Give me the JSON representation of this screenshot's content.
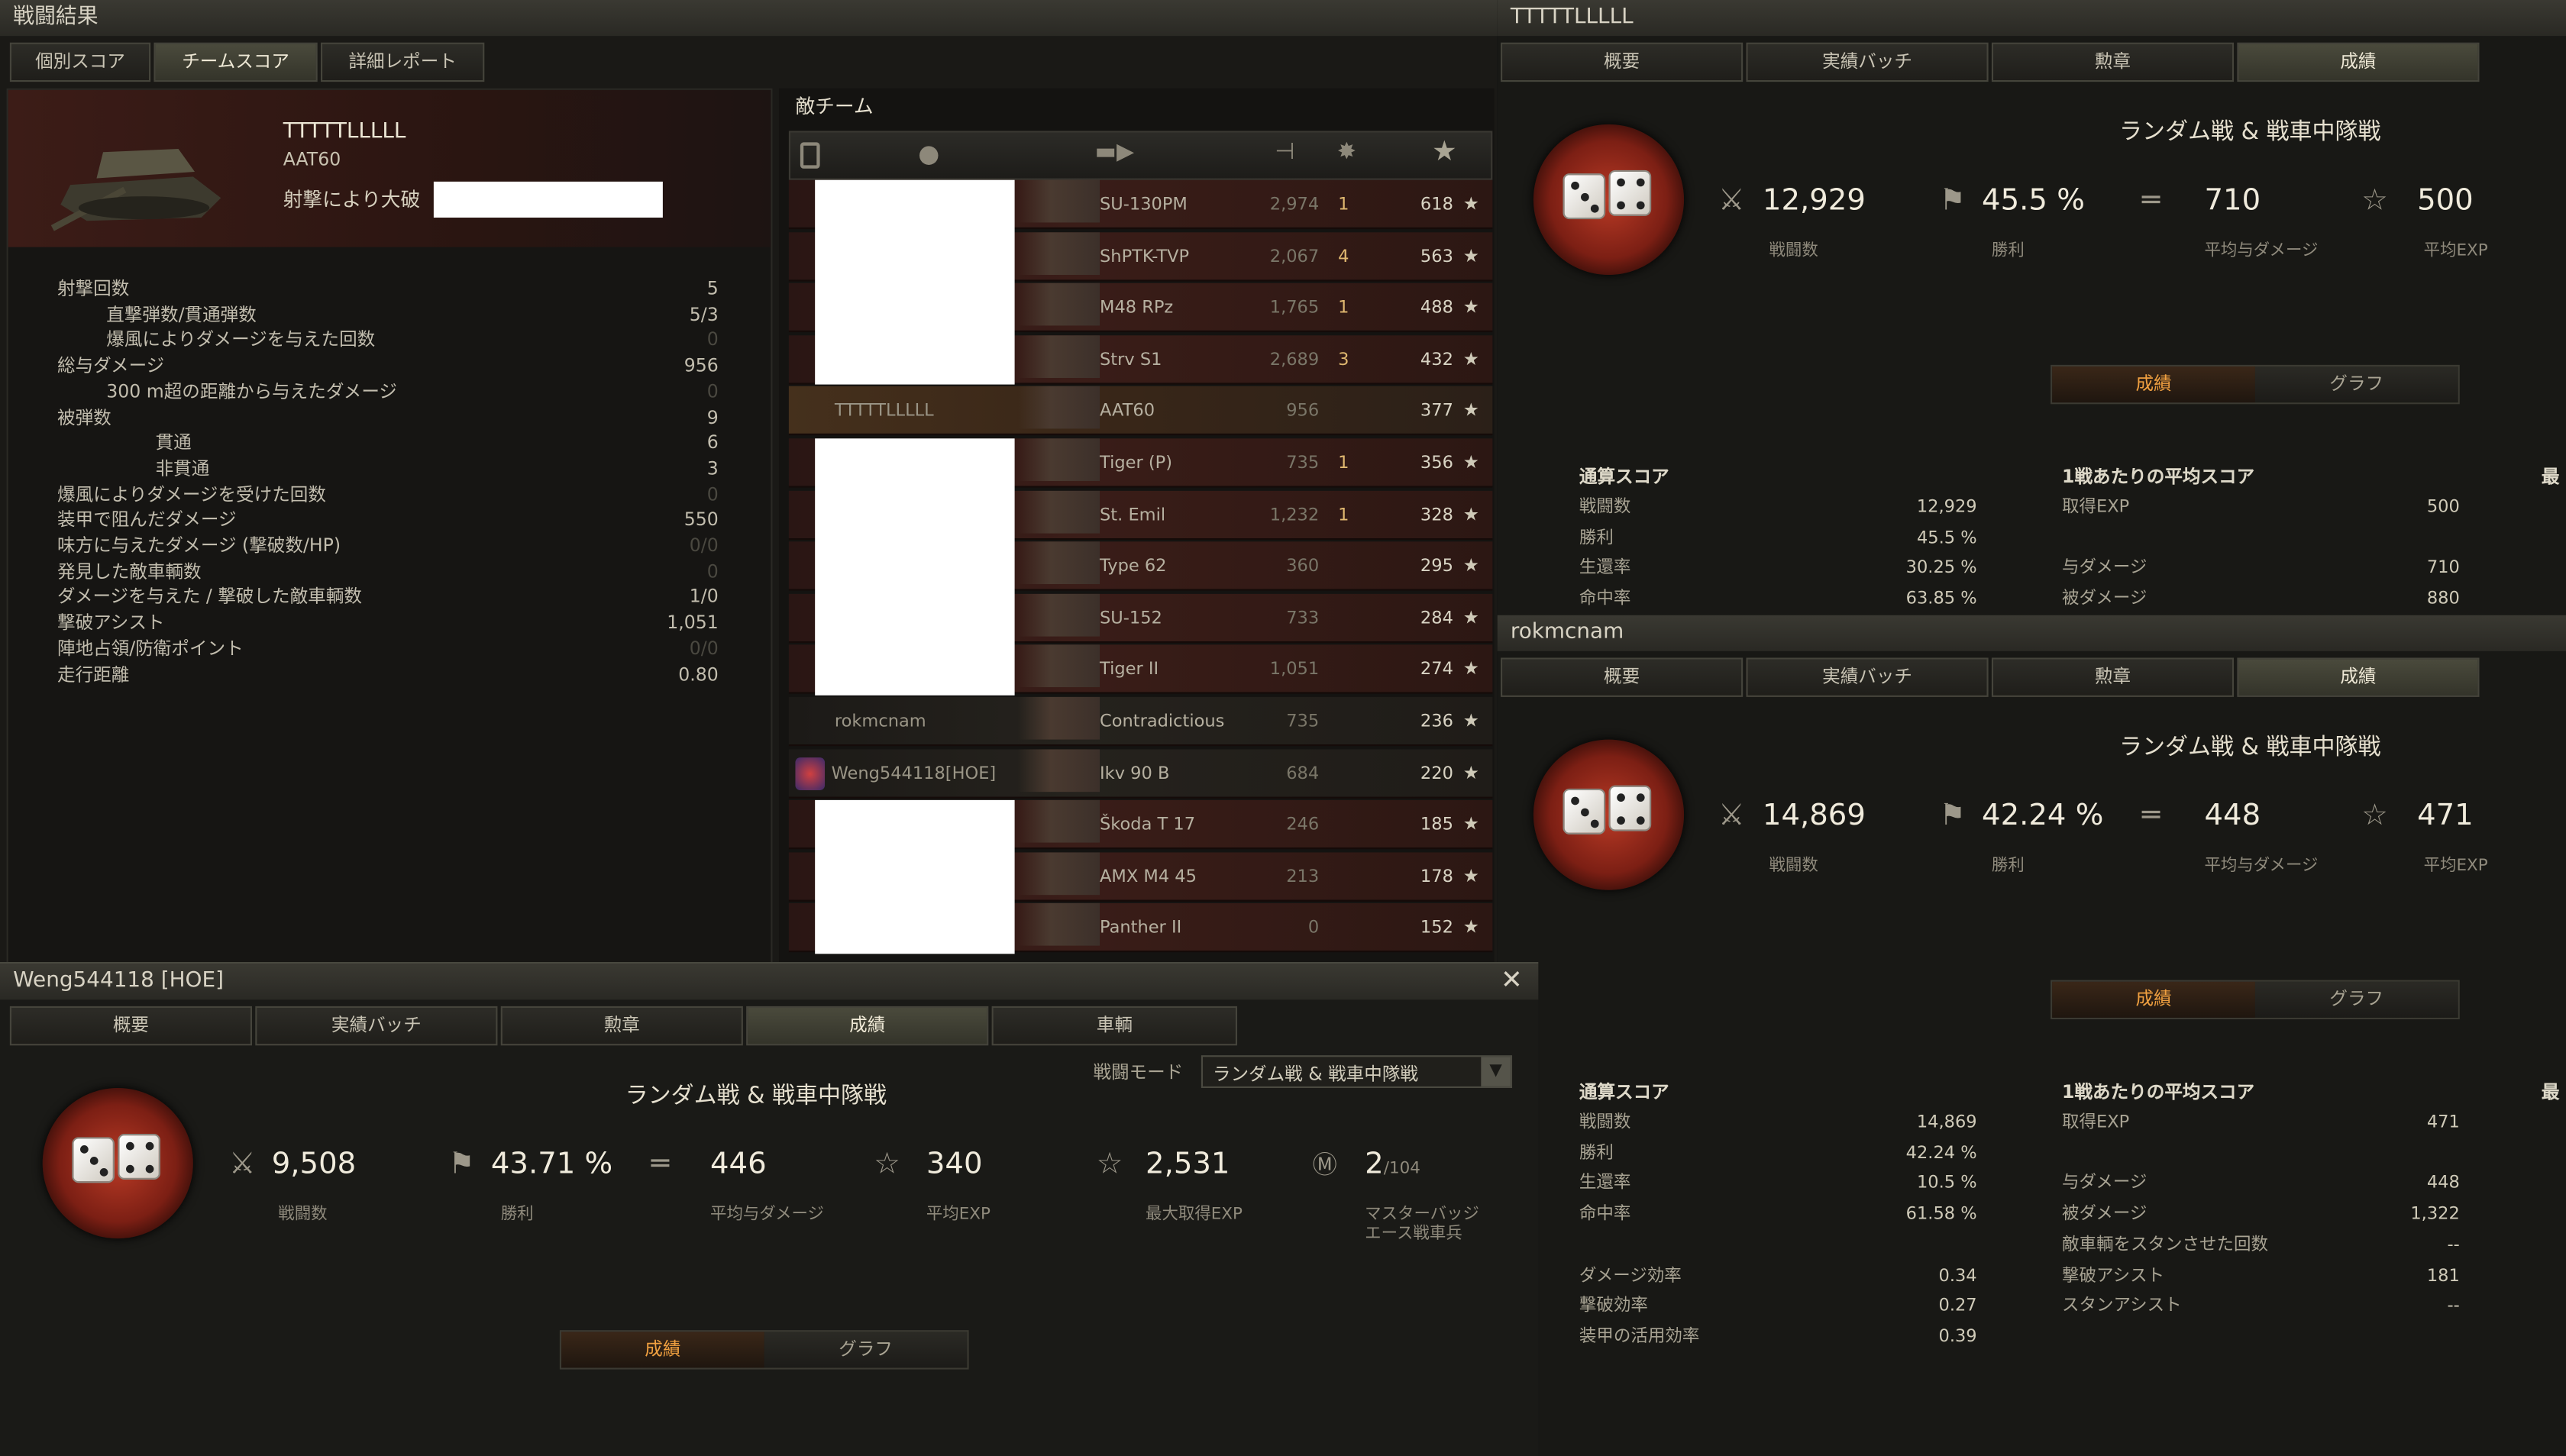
{
  "main_window": {
    "title": "戦闘結果",
    "tabs": [
      "個別スコア",
      "チームスコア",
      "詳細レポート"
    ],
    "active_tab": 1,
    "player_name": "TTTTTLLLLL",
    "tank": "AAT60",
    "destroyed_by": "射撃により大破",
    "stats": [
      {
        "label": "射撃回数",
        "value": "5",
        "indent": 0,
        "dim": false
      },
      {
        "label": "直撃弾数/貫通弾数",
        "value": "5/3",
        "indent": 1,
        "dim": false
      },
      {
        "label": "爆風によりダメージを与えた回数",
        "value": "0",
        "indent": 1,
        "dim": true
      },
      {
        "label": "総与ダメージ",
        "value": "956",
        "indent": 0,
        "dim": false
      },
      {
        "label": "300 m超の距離から与えたダメージ",
        "value": "0",
        "indent": 1,
        "dim": true
      },
      {
        "label": "被弾数",
        "value": "9",
        "indent": 0,
        "dim": false
      },
      {
        "label": "貫通",
        "value": "6",
        "indent": 2,
        "dim": false
      },
      {
        "label": "非貫通",
        "value": "3",
        "indent": 2,
        "dim": false
      },
      {
        "label": "爆風によりダメージを受けた回数",
        "value": "0",
        "indent": 0,
        "dim": true
      },
      {
        "label": "装甲で阻んだダメージ",
        "value": "550",
        "indent": 0,
        "dim": false
      },
      {
        "label": "味方に与えたダメージ (撃破数/HP)",
        "value": "0/0",
        "indent": 0,
        "dim": true
      },
      {
        "label": "発見した敵車輌数",
        "value": "0",
        "indent": 0,
        "dim": true
      },
      {
        "label": "ダメージを与えた / 撃破した敵車輌数",
        "value": "1/0",
        "indent": 0,
        "dim": false
      },
      {
        "label": "撃破アシスト",
        "value": "1,051",
        "indent": 0,
        "dim": false
      },
      {
        "label": "陣地占領/防衛ポイント",
        "value": "0/0",
        "indent": 0,
        "dim": true
      },
      {
        "label": "走行距離",
        "value": "0.80",
        "indent": 0,
        "dim": false
      }
    ],
    "enemy_team": {
      "title": "敵チーム",
      "rows": [
        {
          "name": "",
          "vehicle": "SU-130PM",
          "damage": "2,974",
          "kills": "1",
          "xp": "618",
          "type": "hidden"
        },
        {
          "name": "",
          "vehicle": "ShPTK-TVP",
          "damage": "2,067",
          "kills": "4",
          "xp": "563",
          "type": "hidden"
        },
        {
          "name": "",
          "vehicle": "M48 RPz",
          "damage": "1,765",
          "kills": "1",
          "xp": "488",
          "type": "hidden"
        },
        {
          "name": "",
          "vehicle": "Strv S1",
          "damage": "2,689",
          "kills": "3",
          "xp": "432",
          "type": "hidden"
        },
        {
          "name": "TTTTTLLLLL",
          "vehicle": "AAT60",
          "damage": "956",
          "kills": "",
          "xp": "377",
          "type": "me"
        },
        {
          "name": "",
          "vehicle": "Tiger (P)",
          "damage": "735",
          "kills": "1",
          "xp": "356",
          "type": "hidden"
        },
        {
          "name": "",
          "vehicle": "St. Emil",
          "damage": "1,232",
          "kills": "1",
          "xp": "328",
          "type": "hidden"
        },
        {
          "name": "",
          "vehicle": "Type 62",
          "damage": "360",
          "kills": "",
          "xp": "295",
          "type": "hidden"
        },
        {
          "name": "",
          "vehicle": "SU-152",
          "damage": "733",
          "kills": "",
          "xp": "284",
          "type": "hidden"
        },
        {
          "name": "",
          "vehicle": "Tiger II",
          "damage": "1,051",
          "kills": "",
          "xp": "274",
          "type": "hidden"
        },
        {
          "name": "rokmcnam",
          "vehicle": "Contradictious",
          "damage": "735",
          "kills": "",
          "xp": "236",
          "type": "ally"
        },
        {
          "name": "Weng544118[HOE]",
          "vehicle": "Ikv 90 B",
          "damage": "684",
          "kills": "",
          "xp": "220",
          "type": "ally"
        },
        {
          "name": "",
          "vehicle": "Škoda T 17",
          "damage": "246",
          "kills": "",
          "xp": "185",
          "type": "hidden"
        },
        {
          "name": "",
          "vehicle": "AMX M4 45",
          "damage": "213",
          "kills": "",
          "xp": "178",
          "type": "hidden"
        },
        {
          "name": "",
          "vehicle": "Panther II",
          "damage": "0",
          "kills": "",
          "xp": "152",
          "type": "hidden"
        }
      ]
    }
  },
  "profile_tabs": [
    "概要",
    "実績バッチ",
    "勲章",
    "成績",
    "車輌"
  ],
  "profile_tl": {
    "title": "TTTTTLLLLL",
    "header": "ランダム戦 & 戦車中隊戦",
    "battles": "12,929",
    "battles_label": "戦闘数",
    "winrate": "45.5 %",
    "winrate_label": "勝利",
    "avg_damage": "710",
    "avg_damage_label": "平均与ダメージ",
    "avg_exp": "500",
    "avg_exp_label": "平均EXP",
    "subtabs": [
      "成績",
      "グラフ"
    ],
    "total_title": "通算スコア",
    "total": [
      [
        "戦闘数",
        "12,929"
      ],
      [
        "勝利",
        "45.5 %"
      ],
      [
        "生還率",
        "30.25 %"
      ],
      [
        "命中率",
        "63.85 %"
      ]
    ],
    "avg_title": "1戦あたりの平均スコア",
    "avg": [
      [
        "取得EXP",
        "500"
      ],
      [
        "",
        ""
      ],
      [
        "与ダメージ",
        "710"
      ],
      [
        "被ダメージ",
        "880"
      ]
    ],
    "best_title": "最"
  },
  "profile_rok": {
    "title": "rokmcnam",
    "header": "ランダム戦 & 戦車中隊戦",
    "battles": "14,869",
    "battles_label": "戦闘数",
    "winrate": "42.24 %",
    "winrate_label": "勝利",
    "avg_damage": "448",
    "avg_damage_label": "平均与ダメージ",
    "avg_exp": "471",
    "avg_exp_label": "平均EXP",
    "subtabs": [
      "成績",
      "グラフ"
    ],
    "total_title": "通算スコア",
    "total": [
      [
        "戦闘数",
        "14,869"
      ],
      [
        "勝利",
        "42.24 %"
      ],
      [
        "生還率",
        "10.5 %"
      ],
      [
        "命中率",
        "61.58 %"
      ],
      [
        "",
        ""
      ],
      [
        "ダメージ効率",
        "0.34"
      ],
      [
        "撃破効率",
        "0.27"
      ],
      [
        "装甲の活用効率",
        "0.39"
      ]
    ],
    "avg_title": "1戦あたりの平均スコア",
    "avg": [
      [
        "取得EXP",
        "471"
      ],
      [
        "",
        ""
      ],
      [
        "与ダメージ",
        "448"
      ],
      [
        "被ダメージ",
        "1,322"
      ],
      [
        "敵車輌をスタンさせた回数",
        "--"
      ],
      [
        "撃破アシスト",
        "181"
      ],
      [
        "スタンアシスト",
        "--"
      ]
    ],
    "best_title": "最"
  },
  "profile_weng": {
    "title": "Weng544118 [HOE]",
    "header": "ランダム戦 & 戦車中隊戦",
    "mode_label": "戦闘モード",
    "mode_value": "ランダム戦 & 戦車中隊戦",
    "battles": "9,508",
    "battles_label": "戦闘数",
    "winrate": "43.71 %",
    "winrate_label": "勝利",
    "avg_damage": "446",
    "avg_damage_label": "平均与ダメージ",
    "avg_exp": "340",
    "avg_exp_label": "平均EXP",
    "max_exp": "2,531",
    "max_exp_label": "最大取得EXP",
    "mastery": "2",
    "mastery_total": "/104",
    "mastery_label1": "マスターバッジ",
    "mastery_label2": "エース戦車兵",
    "subtabs": [
      "成績",
      "グラフ"
    ]
  }
}
